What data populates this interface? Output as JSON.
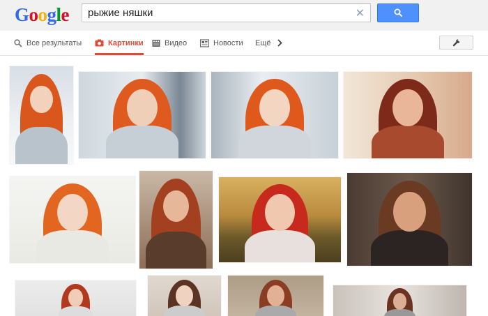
{
  "logo": {
    "letters": [
      "G",
      "o",
      "o",
      "g",
      "l",
      "e"
    ],
    "colors": [
      "#3369e8",
      "#d50f25",
      "#eeb211",
      "#3369e8",
      "#009925",
      "#d50f25"
    ]
  },
  "search": {
    "query": "рыжие няшки",
    "clear_icon": "close-icon",
    "button_icon": "search-icon",
    "button_color": "#4d90fe"
  },
  "nav": {
    "items": [
      {
        "label": "Все результаты",
        "icon": "search-icon",
        "active": false
      },
      {
        "label": "Картинки",
        "icon": "camera-icon",
        "active": true
      },
      {
        "label": "Видео",
        "icon": "film-icon",
        "active": false
      },
      {
        "label": "Новости",
        "icon": "newspaper-icon",
        "active": false
      },
      {
        "label": "Ещё",
        "icon": "",
        "active": false
      }
    ],
    "more_arrow_icon": "chevron-right-icon",
    "tools_icon": "wrench-icon",
    "accent": "#dd4b39"
  },
  "results": {
    "thumbnails": [
      {
        "subject": "redhead-girl-snow"
      },
      {
        "subject": "redhead-girl-fence-snow"
      },
      {
        "subject": "redhead-girl-snowflakes"
      },
      {
        "subject": "redhead-woman-closeup"
      },
      {
        "subject": "redhead-girl-green-eyes"
      },
      {
        "subject": "redhead-girl-selfie"
      },
      {
        "subject": "red-hair-girl-sunset"
      },
      {
        "subject": "long-haired-man-striped-shirt"
      },
      {
        "subject": "red-hair-girl-partial"
      },
      {
        "subject": "brunette-girl-partial"
      },
      {
        "subject": "girl-partial"
      },
      {
        "subject": "girl-partial-2"
      }
    ]
  }
}
